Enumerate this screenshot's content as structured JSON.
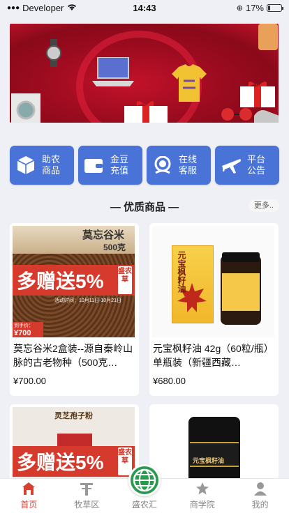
{
  "status_bar": {
    "carrier": "Developer",
    "time": "14:43",
    "battery": "17%",
    "battery_fraction": 0.17
  },
  "quick_actions": [
    {
      "label": "助农商品",
      "icon": "package-icon"
    },
    {
      "label": "金豆充值",
      "icon": "wallet-icon"
    },
    {
      "label": "在线客服",
      "icon": "customer-service-icon"
    },
    {
      "label": "平台公告",
      "icon": "airplane-icon"
    }
  ],
  "section": {
    "title": "— 优质商品 —",
    "more": "更多.."
  },
  "products": [
    {
      "title": "莫忘谷米2盒装--源自秦岭山脉的古老物种（500克…",
      "price": "¥700.00",
      "img_heading": "莫忘谷米",
      "img_sub": "500克",
      "promo": "多赠送5%",
      "promo_tag": "盛农草",
      "img_date": "活动时间：10月11日-10月21日",
      "img_price": "¥700",
      "img_price_label": "到手价："
    },
    {
      "title": "元宝枫籽油 42g（60粒/瓶）单瓶装（新疆西藏…",
      "price": "¥680.00",
      "img_heading": "元宝枫籽油"
    },
    {
      "title": "",
      "price": "",
      "img_heading": "灵芝孢子粉",
      "promo": "多赠送5%",
      "promo_tag": "盛农草"
    },
    {
      "title": "",
      "price": "",
      "img_heading": "元宝枫籽油"
    }
  ],
  "tabbar": [
    {
      "label": "首页",
      "icon": "home-icon",
      "active": true
    },
    {
      "label": "牧草区",
      "icon": "grass-icon",
      "active": false
    },
    {
      "label": "盛农汇",
      "icon": "globe-icon",
      "active": false
    },
    {
      "label": "商学院",
      "icon": "star-icon",
      "active": false
    },
    {
      "label": "我的",
      "icon": "user-icon",
      "active": false
    }
  ]
}
